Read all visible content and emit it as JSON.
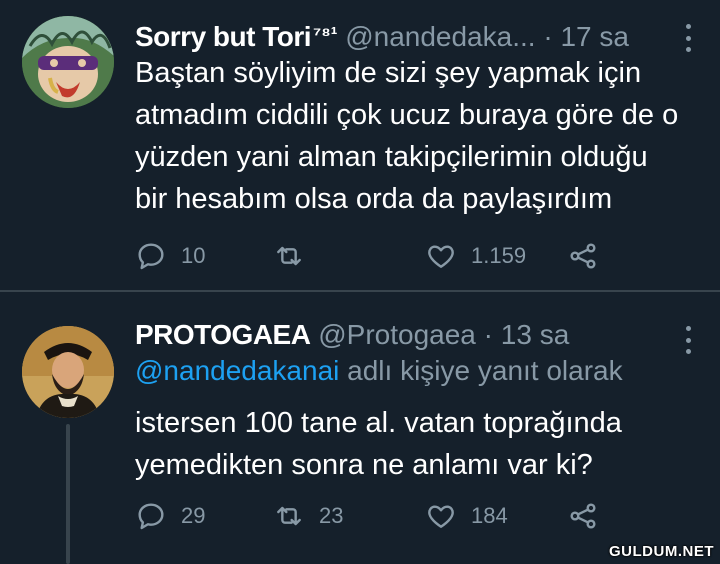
{
  "tweets": [
    {
      "display_name": "Sorry but Tori",
      "badge": "⁷⁸¹",
      "handle": "@nandedaka...",
      "separator": "·",
      "time": "17 sa",
      "lines": [
        "Baştan söyliyim de sizi şey yapmak için",
        "atmadım ciddili çok ucuz buraya göre de o",
        "yüzden yani alman takipçilerimin olduğu",
        "bir hesabım olsa orda da paylaşırdım"
      ],
      "reply_count": "10",
      "retweet_count": "",
      "like_count": "1.159"
    },
    {
      "display_name": "PROTOGAEA",
      "handle": "@Protogaea",
      "separator": "·",
      "time": "13 sa",
      "reply_to_mention": "@nandedakanai",
      "reply_to_suffix": " adlı kişiye yanıt olarak",
      "lines": [
        "istersen 100 tane al. vatan toprağında",
        "yemedikten sonra ne anlamı var ki?"
      ],
      "reply_count": "29",
      "retweet_count": "23",
      "like_count": "184"
    }
  ],
  "watermark": "GULDUM.NET",
  "colors": {
    "background": "#15202b",
    "secondary_text": "#8899a6",
    "mention": "#1da1f2",
    "divider": "#38444d"
  },
  "icons": [
    "reply-icon",
    "retweet-icon",
    "like-icon",
    "share-icon",
    "more-icon"
  ]
}
